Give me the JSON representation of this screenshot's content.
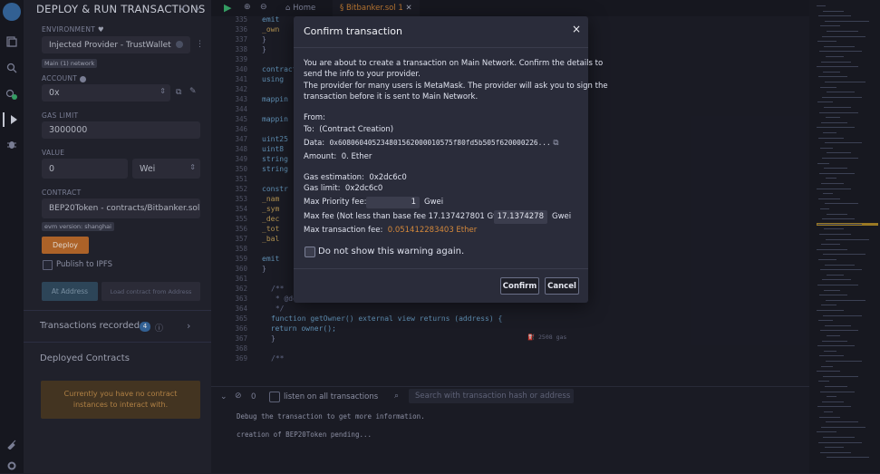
{
  "sidebar": {
    "title": "DEPLOY & RUN TRANSACTIONS",
    "environment_label": "ENVIRONMENT",
    "environment_value": "Injected Provider - TrustWallet",
    "network_badge": "Main (1) network",
    "account_label": "ACCOUNT",
    "account_value": "0x",
    "gas_limit_label": "GAS LIMIT",
    "gas_limit_value": "3000000",
    "value_label": "VALUE",
    "value_amount": "0",
    "value_unit": "Wei",
    "contract_label": "CONTRACT",
    "contract_value": "BEP20Token - contracts/Bitbanker.sol",
    "evm_badge": "evm version: shanghai",
    "deploy_label": "Deploy",
    "publish_label": "Publish to IPFS",
    "at_address_label": "At Address",
    "load_contract_label": "Load contract from Address",
    "transactions_recorded": "Transactions recorded",
    "transactions_count": "4",
    "deployed_contracts": "Deployed Contracts",
    "no_contract_msg": "Currently you have no contract instances to interact with."
  },
  "editor": {
    "tabs": [
      {
        "label": "Home"
      },
      {
        "label": "Bitbanker.sol 1"
      }
    ],
    "lines": [
      {
        "n": "335",
        "text": "emit"
      },
      {
        "n": "336",
        "text": "_own"
      },
      {
        "n": "337",
        "text": "}"
      },
      {
        "n": "338",
        "text": "}"
      },
      {
        "n": "339",
        "text": ""
      },
      {
        "n": "340",
        "text": "contract"
      },
      {
        "n": "341",
        "text": "using"
      },
      {
        "n": "342",
        "text": ""
      },
      {
        "n": "343",
        "text": "mappin"
      },
      {
        "n": "344",
        "text": ""
      },
      {
        "n": "345",
        "text": "mappin"
      },
      {
        "n": "346",
        "text": ""
      },
      {
        "n": "347",
        "text": "uint25"
      },
      {
        "n": "348",
        "text": "uint8"
      },
      {
        "n": "349",
        "text": "string"
      },
      {
        "n": "350",
        "text": "string"
      },
      {
        "n": "351",
        "text": ""
      },
      {
        "n": "352",
        "text": "constr"
      },
      {
        "n": "353",
        "text": "_nam"
      },
      {
        "n": "354",
        "text": "_sym"
      },
      {
        "n": "355",
        "text": "_dec"
      },
      {
        "n": "356",
        "text": "_tot"
      },
      {
        "n": "357",
        "text": "_bal"
      },
      {
        "n": "358",
        "text": ""
      },
      {
        "n": "359",
        "text": "emit"
      },
      {
        "n": "360",
        "text": "}"
      },
      {
        "n": "361",
        "text": ""
      },
      {
        "n": "362",
        "text": "/**"
      },
      {
        "n": "363",
        "text": " * @dev Returns the bep token owner."
      },
      {
        "n": "364",
        "text": " */"
      },
      {
        "n": "365",
        "text": "function getOwner() external view returns (address) {"
      },
      {
        "n": "366",
        "text": "  return owner();"
      },
      {
        "n": "367",
        "text": "}"
      },
      {
        "n": "368",
        "text": ""
      },
      {
        "n": "369",
        "text": "/**"
      }
    ],
    "gas_hint": "2508 gas"
  },
  "terminal": {
    "count": "0",
    "listen_label": "listen on all transactions",
    "search_placeholder": "Search with transaction hash or address",
    "lines": [
      "Debug the transaction to get more information.",
      "creation of BEP20Token pending..."
    ]
  },
  "modal": {
    "title": "Confirm transaction",
    "close": "×",
    "intro1": "You are about to create a transaction on Main Network. Confirm the details to",
    "intro2": "send the info to your provider.",
    "intro3": "The provider for many users is MetaMask. The provider will ask you to sign the",
    "intro4": "transaction before it is sent to Main Network.",
    "from_label": "From:",
    "to_label": "To:",
    "to_value": "(Contract Creation)",
    "data_label": "Data:",
    "data_value": "0x608060405234801562000010575f80fd5b505f620000226...",
    "amount_label": "Amount:",
    "amount_value": "0. Ether",
    "gas_estimation_label": "Gas estimation:",
    "gas_estimation_value": "0x2dc6c0",
    "gas_limit_label": "Gas limit:",
    "gas_limit_value": "0x2dc6c0",
    "max_priority_label": "Max Priority fee:",
    "max_priority_value": "1",
    "max_priority_unit": "Gwei",
    "max_fee_label": "Max fee (Not less than base fee 17.137427801 Gwei):",
    "max_fee_value": "17.1374278",
    "max_fee_unit": "Gwei",
    "max_tx_fee_label": "Max transaction fee:",
    "max_tx_fee_value": "0.051412283403 Ether",
    "dont_show_label": "Do not show this warning again.",
    "confirm_label": "Confirm",
    "cancel_label": "Cancel"
  },
  "colors": {
    "accent_orange": "#c97d3a",
    "warning_text": "#d4883a",
    "deploy_bg": "#c4702e"
  }
}
